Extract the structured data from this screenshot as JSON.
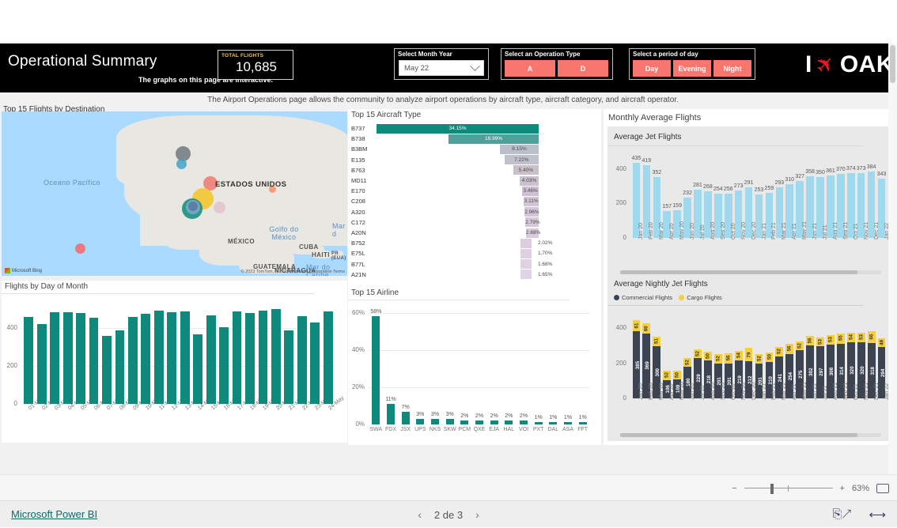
{
  "header": {
    "title": "Operational Summary",
    "subtitle": "The graphs on this page are interactive.",
    "description": "The Airport Operations page allows the community to analyze airport operations by aircraft type, aircraft category, and aircraft operator.",
    "kpi": {
      "label": "TOTAL FLIGHTS",
      "value": "10,685"
    },
    "logo": {
      "i": "I",
      "plane": "plane-icon",
      "code": "OAK"
    },
    "slicers": {
      "month_year": {
        "title": "Select Month Year",
        "value": "May 22"
      },
      "operation_type": {
        "title": "Select an Operation Type",
        "options": [
          "A",
          "D"
        ]
      },
      "period_of_day": {
        "title": "Select a period of day",
        "options": [
          "Day",
          "Evening",
          "Night"
        ]
      }
    },
    "colors": {
      "accent_red": "#f9766e",
      "kpi_label": "#f2c14e",
      "teal": "#0e8a7d",
      "logo_red": "#e01b24"
    }
  },
  "panels": {
    "map_title": "Top 15 Flights by Destination",
    "aircraft_title": "Top 15 Aircraft Type",
    "monthly_title": "Monthly Average Flights",
    "day_title": "Flights by Day of Month",
    "airline_title": "Top 15 Airline"
  },
  "map": {
    "labels": [
      "Oceano Pacífico",
      "ESTADOS UNIDOS",
      "MÉXICO",
      "Golfo do México",
      "CUBA",
      "HAITI",
      "PR (EUA)",
      "GUATEMALA",
      "NICARAGUA",
      "Mar do Caribe",
      "Mar d"
    ],
    "attribution": "© 2023 TomTom, © 2023 Microsoft Corporation  Terms",
    "provider": "Microsoft Bing"
  },
  "chart_data": [
    {
      "type": "bar",
      "orientation": "horizontal",
      "title": "Top 15 Aircraft Type",
      "categories": [
        "B737",
        "B738",
        "B3BM",
        "E135",
        "B763",
        "MD11",
        "E170",
        "C208",
        "A320",
        "C172",
        "A20N",
        "B752",
        "E75L",
        "B77L",
        "A21N"
      ],
      "values": [
        34.15,
        18.99,
        8.15,
        7.22,
        5.4,
        4.03,
        3.46,
        3.11,
        2.96,
        2.79,
        2.68,
        2.02,
        1.7,
        1.68,
        1.65
      ],
      "value_labels": [
        "34.15%",
        "18.99%",
        "8.15%",
        "7.22%",
        "5.40%",
        "4.03%",
        "3.46%",
        "3.11%",
        "2.96%",
        "2.79%",
        "2.68%",
        "2.02%",
        "1.70%",
        "1.68%",
        "1.65%"
      ],
      "xlabel": "",
      "ylabel": "",
      "grid": false
    },
    {
      "type": "bar",
      "title": "Average Jet Flights",
      "categories": [
        "Jan 20",
        "Feb 20",
        "Mar 20",
        "Apr 20",
        "May 20",
        "Jun 20",
        "Jul 20",
        "Aug 20",
        "Sep 20",
        "Oct 20",
        "Nov 20",
        "Dec 20",
        "Jan 21",
        "Feb 21",
        "Mar 21",
        "Apr 21",
        "May 21",
        "Jun 21",
        "Jul 21",
        "Aug 21",
        "Sep 21",
        "Oct 21",
        "Nov 21",
        "Dec 21",
        "Jan 22"
      ],
      "values": [
        435,
        419,
        352,
        157,
        159,
        232,
        281,
        268,
        254,
        256,
        273,
        291,
        253,
        259,
        293,
        310,
        327,
        358,
        350,
        361,
        370,
        374,
        373,
        384,
        343
      ],
      "ylim": [
        0,
        480
      ],
      "yticks": [
        0,
        200,
        400
      ],
      "ylabel": "",
      "xlabel": "",
      "grid": false,
      "color": "#9fd9ee"
    },
    {
      "type": "bar",
      "subtype": "stacked",
      "title": "Average Nightly Jet Flights",
      "categories": [
        "Jan 20",
        "Feb 20",
        "Mar 20",
        "Apr 20",
        "May 20",
        "Jun 20",
        "Jul 20",
        "Aug 20",
        "Sep 20",
        "Oct 20",
        "Nov 20",
        "Dec 20",
        "Jan 21",
        "Feb 21",
        "Mar 21",
        "Apr 21",
        "May 21",
        "Jun 21",
        "Jul 21",
        "Aug 21",
        "Sep 21",
        "Oct 21",
        "Nov 21",
        "Dec 21",
        "Jan 22"
      ],
      "series": [
        {
          "name": "Commercial Flights",
          "color": "#3b4450",
          "values": [
            385,
            369,
            300,
            106,
            109,
            180,
            229,
            218,
            201,
            201,
            219,
            212,
            201,
            210,
            241,
            254,
            275,
            302,
            297,
            308,
            314,
            320,
            320,
            318,
            294
          ]
        },
        {
          "name": "Cargo Flights",
          "color": "#f5cf3e",
          "values": [
            61,
            60,
            51,
            52,
            50,
            52,
            52,
            50,
            52,
            56,
            54,
            79,
            52,
            50,
            52,
            56,
            52,
            56,
            53,
            53,
            55,
            54,
            53,
            66,
            49
          ]
        }
      ],
      "ylim": [
        0,
        470
      ],
      "yticks": [
        0,
        200,
        400
      ],
      "legend_position": "top"
    },
    {
      "type": "bar",
      "title": "Flights by Day of Month",
      "categories": [
        "01-May",
        "02-May",
        "03-May",
        "04-May",
        "05-May",
        "06-May",
        "07-May",
        "08-May",
        "09-May",
        "10-May",
        "11-May",
        "12-May",
        "13-May",
        "14-May",
        "15-May",
        "16-May",
        "17-May",
        "18-May",
        "19-May",
        "20-May",
        "21-May",
        "22-May",
        "23-May",
        "24-May"
      ],
      "values": [
        455,
        419,
        480,
        483,
        477,
        452,
        357,
        386,
        457,
        473,
        491,
        481,
        486,
        365,
        467,
        402,
        487,
        478,
        490,
        500,
        388,
        463,
        428,
        484
      ],
      "ylim": [
        0,
        540
      ],
      "yticks": [
        0,
        200,
        400
      ],
      "color": "#0e8a7d",
      "grid": true
    },
    {
      "type": "bar",
      "title": "Top 15 Airline",
      "categories": [
        "SWA",
        "FDX",
        "JSX",
        "UPS",
        "NKS",
        "SKW",
        "PCM",
        "QXE",
        "EJA",
        "HAL",
        "VOI",
        "PXT",
        "DAL",
        "ASA",
        "FFT"
      ],
      "values": [
        58,
        11,
        7,
        3,
        3,
        3,
        2,
        2,
        2,
        2,
        2,
        1,
        1,
        1,
        1
      ],
      "value_labels": [
        "58%",
        "11%",
        "7%",
        "3%",
        "3%",
        "3%",
        "2%",
        "2%",
        "2%",
        "2%",
        "2%",
        "1%",
        "1%",
        "1%",
        "1%"
      ],
      "ylim": [
        0,
        62
      ],
      "yticks": [
        0,
        20,
        40,
        60
      ],
      "ytick_labels": [
        "0%",
        "20%",
        "40%",
        "60%"
      ],
      "color": "#0e8a7d",
      "grid": true
    }
  ],
  "statusbar": {
    "zoom_level": "63%",
    "minus": "−",
    "plus": "+",
    "fit_icon": "fit-to-page-icon"
  },
  "footer": {
    "brand": "Microsoft Power BI",
    "page_indicator": "2 de 3",
    "prev": "‹",
    "next": "›",
    "share_icon": "share-icon",
    "fullscreen_icon": "fullscreen-icon"
  }
}
